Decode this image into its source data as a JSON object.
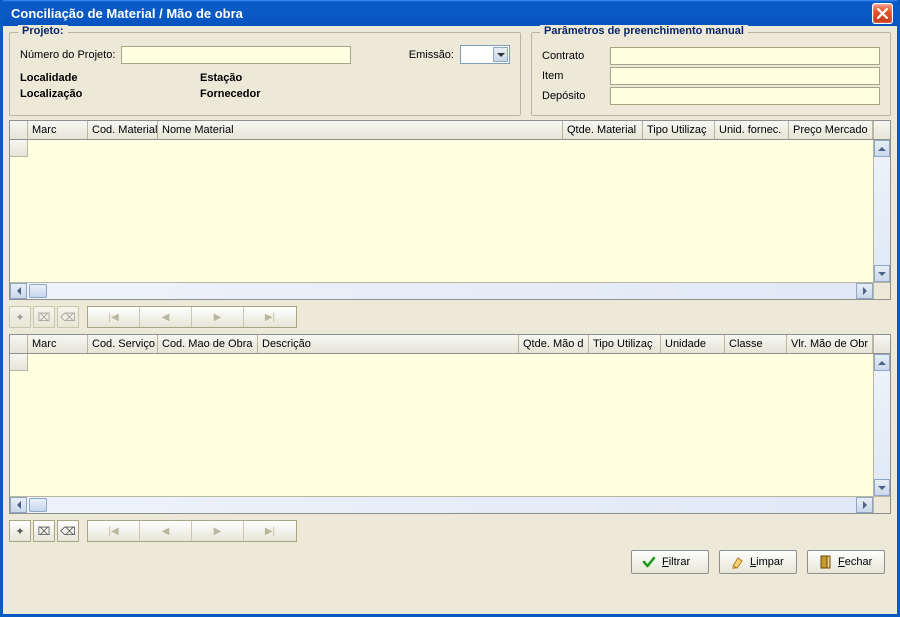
{
  "window": {
    "title": "Conciliação de Material / Mão de obra"
  },
  "projeto": {
    "legend": "Projeto:",
    "numero_label": "Número do Projeto:",
    "numero_value": "",
    "emissao_label": "Emissão:",
    "emissao_value": "",
    "localidade_label": "Localidade",
    "localizacao_label": "Localização",
    "estacao_label": "Estação",
    "fornecedor_label": "Fornecedor"
  },
  "param": {
    "legend": "Parâmetros de preenchimento manual",
    "contrato_label": "Contrato",
    "contrato_value": "",
    "item_label": "Item",
    "item_value": "",
    "deposito_label": "Depósito",
    "deposito_value": ""
  },
  "grid1": {
    "columns": [
      "Marc",
      "Cod. Material",
      "Nome Material",
      "Qtde. Material",
      "Tipo Utilizaç",
      "Unid. fornec.",
      "Preço Mercado"
    ]
  },
  "grid2": {
    "columns": [
      "Marc",
      "Cod. Serviço",
      "Cod. Mao de Obra",
      "Descrição",
      "Qtde. Mão d",
      "Tipo Utilizaç",
      "Unidade",
      "Classe",
      "Vlr. Mão de Obr"
    ]
  },
  "nav": {
    "first": "|◀",
    "prev": "◀",
    "next": "▶",
    "last": "▶|"
  },
  "buttons": {
    "filtrar": "Filtrar",
    "limpar": "Limpar",
    "fechar": "Fechar"
  }
}
